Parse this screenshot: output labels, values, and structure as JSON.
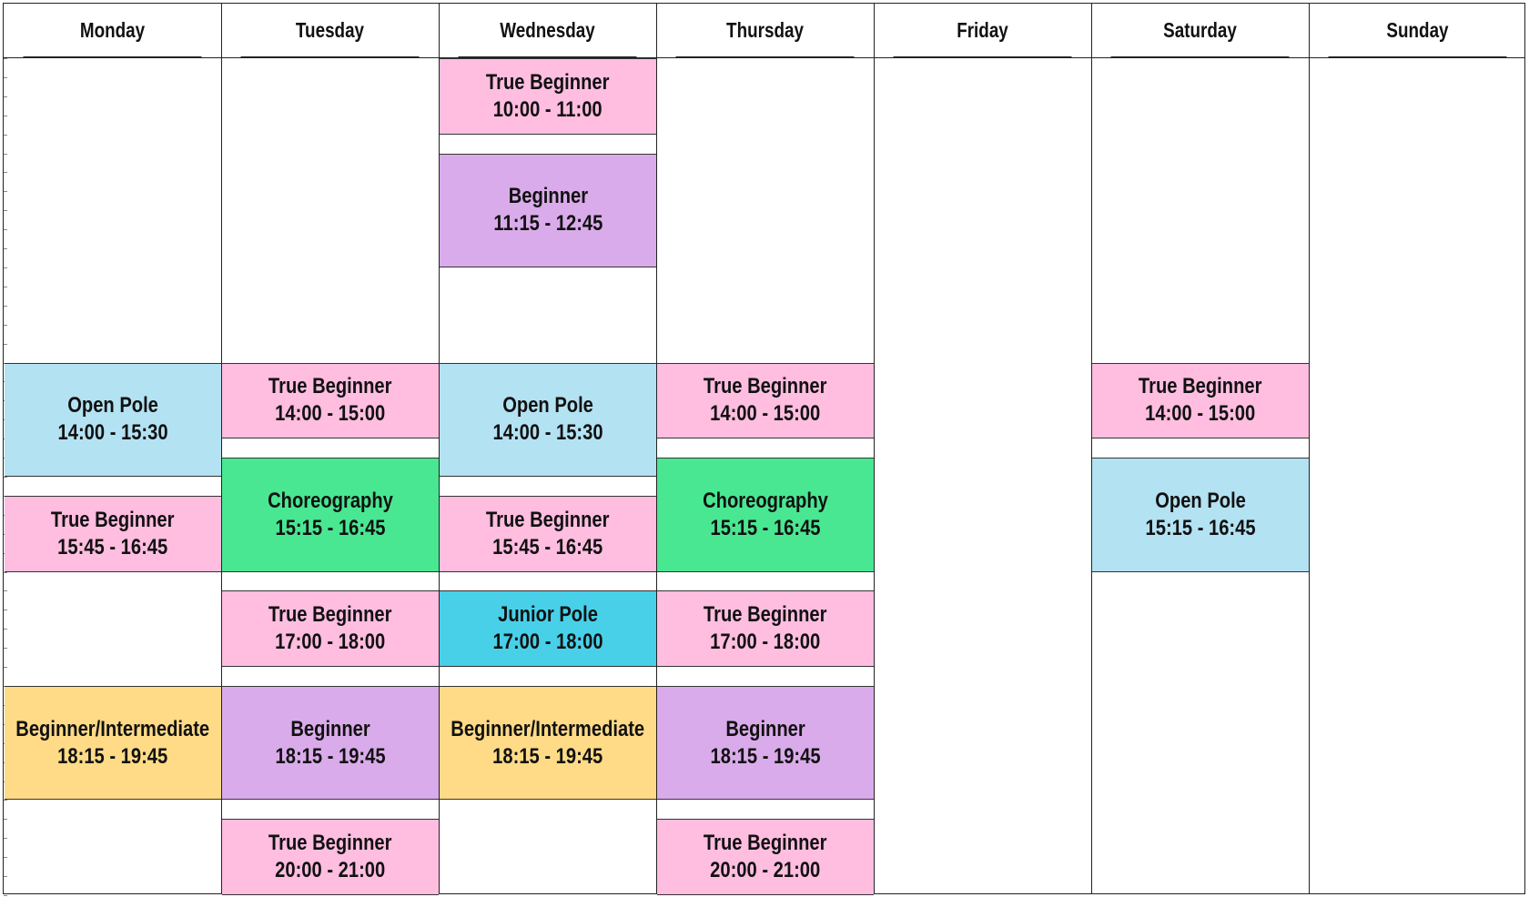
{
  "days": [
    "Monday",
    "Tuesday",
    "Wednesday",
    "Thursday",
    "Friday",
    "Saturday",
    "Sunday"
  ],
  "class_colors": {
    "True Beginner": "#ffbde0",
    "Beginner": "#daabea",
    "Open Pole": "#b3e2f2",
    "Choreography": "#49e792",
    "Junior Pole": "#48d0e9",
    "Beginner/Intermediate": "#ffdb87"
  },
  "schedule": {
    "start": "10:00",
    "end": "21:00"
  },
  "classes": [
    {
      "day": 0,
      "name": "Open Pole",
      "time": "14:00 - 15:30",
      "start": "14:00",
      "end": "15:30"
    },
    {
      "day": 0,
      "name": "True Beginner",
      "time": "15:45 - 16:45",
      "start": "15:45",
      "end": "16:45"
    },
    {
      "day": 0,
      "name": "Beginner/Intermediate",
      "time": "18:15 - 19:45",
      "start": "18:15",
      "end": "19:45"
    },
    {
      "day": 1,
      "name": "True Beginner",
      "time": "14:00 - 15:00",
      "start": "14:00",
      "end": "15:00"
    },
    {
      "day": 1,
      "name": "Choreography",
      "time": "15:15 - 16:45",
      "start": "15:15",
      "end": "16:45"
    },
    {
      "day": 1,
      "name": "True Beginner",
      "time": "17:00 - 18:00",
      "start": "17:00",
      "end": "18:00"
    },
    {
      "day": 1,
      "name": "Beginner",
      "time": "18:15 - 19:45",
      "start": "18:15",
      "end": "19:45"
    },
    {
      "day": 1,
      "name": "True Beginner",
      "time": "20:00 - 21:00",
      "start": "20:00",
      "end": "21:00"
    },
    {
      "day": 2,
      "name": "True Beginner",
      "time": "10:00 - 11:00",
      "start": "10:00",
      "end": "11:00"
    },
    {
      "day": 2,
      "name": "Beginner",
      "time": "11:15 - 12:45",
      "start": "11:15",
      "end": "12:45"
    },
    {
      "day": 2,
      "name": "Open Pole",
      "time": "14:00 - 15:30",
      "start": "14:00",
      "end": "15:30"
    },
    {
      "day": 2,
      "name": "True Beginner",
      "time": "15:45 - 16:45",
      "start": "15:45",
      "end": "16:45"
    },
    {
      "day": 2,
      "name": "Junior Pole",
      "time": "17:00 - 18:00",
      "start": "17:00",
      "end": "18:00"
    },
    {
      "day": 2,
      "name": "Beginner/Intermediate",
      "time": "18:15 - 19:45",
      "start": "18:15",
      "end": "19:45"
    },
    {
      "day": 3,
      "name": "True Beginner",
      "time": "14:00 - 15:00",
      "start": "14:00",
      "end": "15:00"
    },
    {
      "day": 3,
      "name": "Choreography",
      "time": "15:15 - 16:45",
      "start": "15:15",
      "end": "16:45"
    },
    {
      "day": 3,
      "name": "True Beginner",
      "time": "17:00 - 18:00",
      "start": "17:00",
      "end": "18:00"
    },
    {
      "day": 3,
      "name": "Beginner",
      "time": "18:15 - 19:45",
      "start": "18:15",
      "end": "19:45"
    },
    {
      "day": 3,
      "name": "True Beginner",
      "time": "20:00 - 21:00",
      "start": "20:00",
      "end": "21:00"
    },
    {
      "day": 5,
      "name": "True Beginner",
      "time": "14:00 - 15:00",
      "start": "14:00",
      "end": "15:00"
    },
    {
      "day": 5,
      "name": "Open Pole",
      "time": "15:15 - 16:45",
      "start": "15:15",
      "end": "16:45"
    }
  ]
}
